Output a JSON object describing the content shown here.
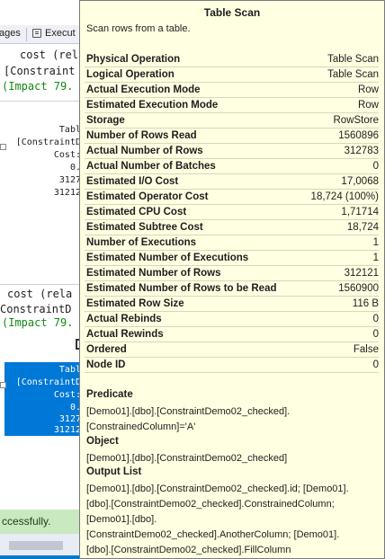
{
  "background": {
    "tabs": {
      "tab1": "ages",
      "tab2": "Execut"
    },
    "upper_node": {
      "line1": "cost (rela",
      "line2": "[Constraint",
      "line3": "(Impact 79."
    },
    "node1": {
      "name": "Tabl",
      "obj": "[ConstraintD",
      "cost": "Cost:",
      "v1": "0.",
      "v2": "3127",
      "v3": "31212"
    },
    "lower_node": {
      "line1": "cost (rela",
      "line2": "ConstraintD",
      "line3": "(Impact 79."
    },
    "selected_node": {
      "name": "Tabl",
      "obj": "[ConstraintD",
      "cost": "Cost:",
      "v1": "0.",
      "v2": "3127",
      "v3": "31212"
    },
    "status": "ccessfully."
  },
  "tooltip": {
    "title": "Table Scan",
    "description": "Scan rows from a table.",
    "properties": [
      {
        "label": "Physical Operation",
        "value": "Table Scan"
      },
      {
        "label": "Logical Operation",
        "value": "Table Scan"
      },
      {
        "label": "Actual Execution Mode",
        "value": "Row"
      },
      {
        "label": "Estimated Execution Mode",
        "value": "Row"
      },
      {
        "label": "Storage",
        "value": "RowStore"
      },
      {
        "label": "Number of Rows Read",
        "value": "1560896"
      },
      {
        "label": "Actual Number of Rows",
        "value": "312783"
      },
      {
        "label": "Actual Number of Batches",
        "value": "0"
      },
      {
        "label": "Estimated I/O Cost",
        "value": "17,0068"
      },
      {
        "label": "Estimated Operator Cost",
        "value": "18,724 (100%)"
      },
      {
        "label": "Estimated CPU Cost",
        "value": "1,71714"
      },
      {
        "label": "Estimated Subtree Cost",
        "value": "18,724"
      },
      {
        "label": "Number of Executions",
        "value": "1"
      },
      {
        "label": "Estimated Number of Executions",
        "value": "1"
      },
      {
        "label": "Estimated Number of Rows",
        "value": "312121"
      },
      {
        "label": "Estimated Number of Rows to be Read",
        "value": "1560900"
      },
      {
        "label": "Estimated Row Size",
        "value": "116 B"
      },
      {
        "label": "Actual Rebinds",
        "value": "0"
      },
      {
        "label": "Actual Rewinds",
        "value": "0"
      },
      {
        "label": "Ordered",
        "value": "False"
      },
      {
        "label": "Node ID",
        "value": "0"
      }
    ],
    "predicate": {
      "heading": "Predicate",
      "line1": "[Demo01].[dbo].[ConstraintDemo02_checked].",
      "line2": "[ConstrainedColumn]='A'"
    },
    "object": {
      "heading": "Object",
      "line1": "[Demo01].[dbo].[ConstraintDemo02_checked]"
    },
    "output_list": {
      "heading": "Output List",
      "line1": "[Demo01].[dbo].[ConstraintDemo02_checked].id; [Demo01].",
      "line2": "[dbo].[ConstraintDemo02_checked].ConstrainedColumn;",
      "line3": "[Demo01].[dbo].",
      "line4": "[ConstraintDemo02_checked].AnotherColumn; [Demo01].",
      "line5": "[dbo].[ConstraintDemo02_checked].FillColumn"
    }
  }
}
